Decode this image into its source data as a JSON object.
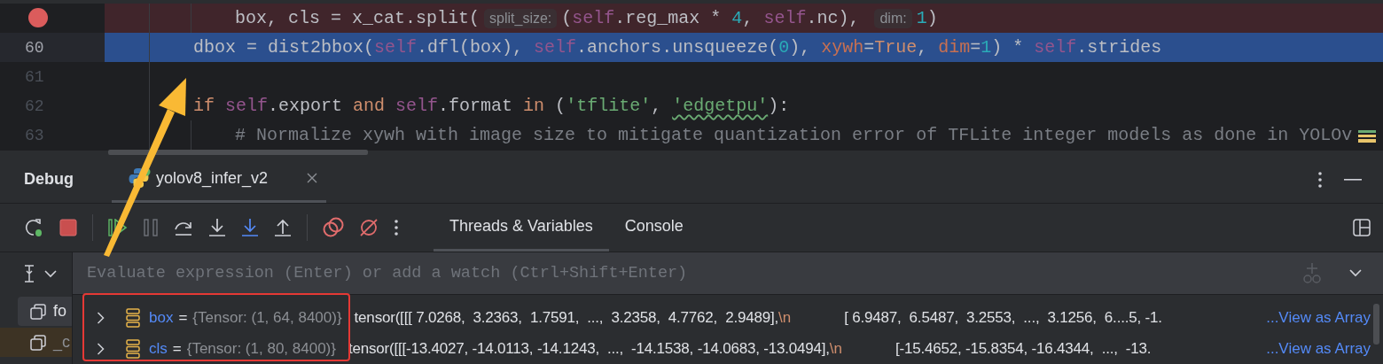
{
  "editor": {
    "lines": [
      {
        "breakpoint": true,
        "current": false,
        "nested": true,
        "tokens": [
          {
            "kind": "plain",
            "text": "box, cls = x_cat.split("
          },
          {
            "kind": "hint",
            "text": "split_size:"
          },
          {
            "kind": "plain",
            "text": "("
          },
          {
            "kind": "self",
            "text": "self"
          },
          {
            "kind": "plain",
            "text": ".reg_max * "
          },
          {
            "kind": "number",
            "text": "4"
          },
          {
            "kind": "plain",
            "text": ", "
          },
          {
            "kind": "self",
            "text": "self"
          },
          {
            "kind": "plain",
            "text": ".nc), "
          },
          {
            "kind": "hint",
            "text": "dim:"
          },
          {
            "kind": "number",
            "text": "1"
          },
          {
            "kind": "plain",
            "text": ")"
          }
        ]
      },
      {
        "number": "60",
        "breakpoint": false,
        "current": true,
        "nested": false,
        "tokens": [
          {
            "kind": "plain",
            "text": "dbox = dist2bbox("
          },
          {
            "kind": "self",
            "text": "self"
          },
          {
            "kind": "plain",
            "text": ".dfl(box), "
          },
          {
            "kind": "self",
            "text": "self"
          },
          {
            "kind": "plain",
            "text": ".anchors.unsqueeze("
          },
          {
            "kind": "number",
            "text": "0"
          },
          {
            "kind": "plain",
            "text": "), "
          },
          {
            "kind": "param",
            "text": "xywh"
          },
          {
            "kind": "plain",
            "text": "="
          },
          {
            "kind": "keyword",
            "text": "True"
          },
          {
            "kind": "plain",
            "text": ", "
          },
          {
            "kind": "param",
            "text": "dim"
          },
          {
            "kind": "plain",
            "text": "="
          },
          {
            "kind": "number",
            "text": "1"
          },
          {
            "kind": "plain",
            "text": ") * "
          },
          {
            "kind": "self",
            "text": "self"
          },
          {
            "kind": "plain",
            "text": ".strides"
          }
        ]
      },
      {
        "number": "61",
        "breakpoint": false,
        "current": false,
        "nested": false
      },
      {
        "number": "62",
        "breakpoint": false,
        "current": false,
        "nested": false,
        "tokens": [
          {
            "kind": "keyword",
            "text": "if "
          },
          {
            "kind": "self",
            "text": "self"
          },
          {
            "kind": "plain",
            "text": ".export "
          },
          {
            "kind": "keyword",
            "text": "and "
          },
          {
            "kind": "self",
            "text": "self"
          },
          {
            "kind": "plain",
            "text": ".format "
          },
          {
            "kind": "keyword",
            "text": "in "
          },
          {
            "kind": "plain",
            "text": "("
          },
          {
            "kind": "string",
            "text": "'tflite'"
          },
          {
            "kind": "plain",
            "text": ", "
          },
          {
            "kind": "string",
            "text": "'edgetpu'",
            "typo": true
          },
          {
            "kind": "plain",
            "text": "):"
          }
        ]
      },
      {
        "number": "63",
        "breakpoint": false,
        "current": false,
        "nested": true,
        "tokens": [
          {
            "kind": "comment",
            "text": "# Normalize xywh with image size to mitigate quantization error of TFLite integer models as done in YOLOv"
          }
        ]
      }
    ]
  },
  "debug": {
    "title": "Debug",
    "session_tab": {
      "label": "yolov8_infer_v2"
    },
    "toolbar": [
      {
        "kind": "rerun",
        "disabled": false
      },
      {
        "kind": "stop",
        "disabled": false
      },
      {
        "kind": "divider"
      },
      {
        "kind": "resume",
        "disabled": false
      },
      {
        "kind": "pause",
        "disabled": true
      },
      {
        "kind": "step-over",
        "disabled": false
      },
      {
        "kind": "step-into",
        "disabled": false
      },
      {
        "kind": "step-into-my-code",
        "disabled": false
      },
      {
        "kind": "step-out",
        "disabled": false
      },
      {
        "kind": "divider"
      },
      {
        "kind": "breakpoints",
        "disabled": false
      },
      {
        "kind": "mute-breakpoints",
        "disabled": false
      },
      {
        "kind": "more",
        "disabled": false
      }
    ],
    "tabs": [
      {
        "label": "Threads & Variables",
        "selected": true
      },
      {
        "label": "Console",
        "selected": false
      }
    ],
    "evaluate": {
      "placeholder": "Evaluate expression (Enter) or add a watch (Ctrl+Shift+Enter)"
    },
    "frames": [
      {
        "label": "fo",
        "selected": true,
        "library": false
      },
      {
        "label": "_c",
        "selected": false,
        "library": true
      }
    ],
    "variables": [
      {
        "name": "box",
        "separator": "=",
        "type": "{Tensor: (1, 64, 8400)}",
        "value": "tensor([[[ 7.0268,  3.2363,  1.7591,  ...,  3.2358,  4.7762,  2.9489],",
        "escape": "\\n",
        "value_rest": "[ 6.9487,  6.5487,  3.2553,  ...,  3.1256,  6....5, -1.",
        "link": "...View as Array",
        "expanded": false
      },
      {
        "name": "cls",
        "separator": "=",
        "type": "{Tensor: (1, 80, 8400)}",
        "value": "tensor([[[-13.4027, -14.0113, -14.1243,  ...,  -14.1538, -14.0683, -13.0494],",
        "escape": "\\n",
        "value_rest": "[-15.4652, -15.8354, -16.4344,  ...,  -13.",
        "link": "...View as Array",
        "expanded": false
      }
    ]
  }
}
